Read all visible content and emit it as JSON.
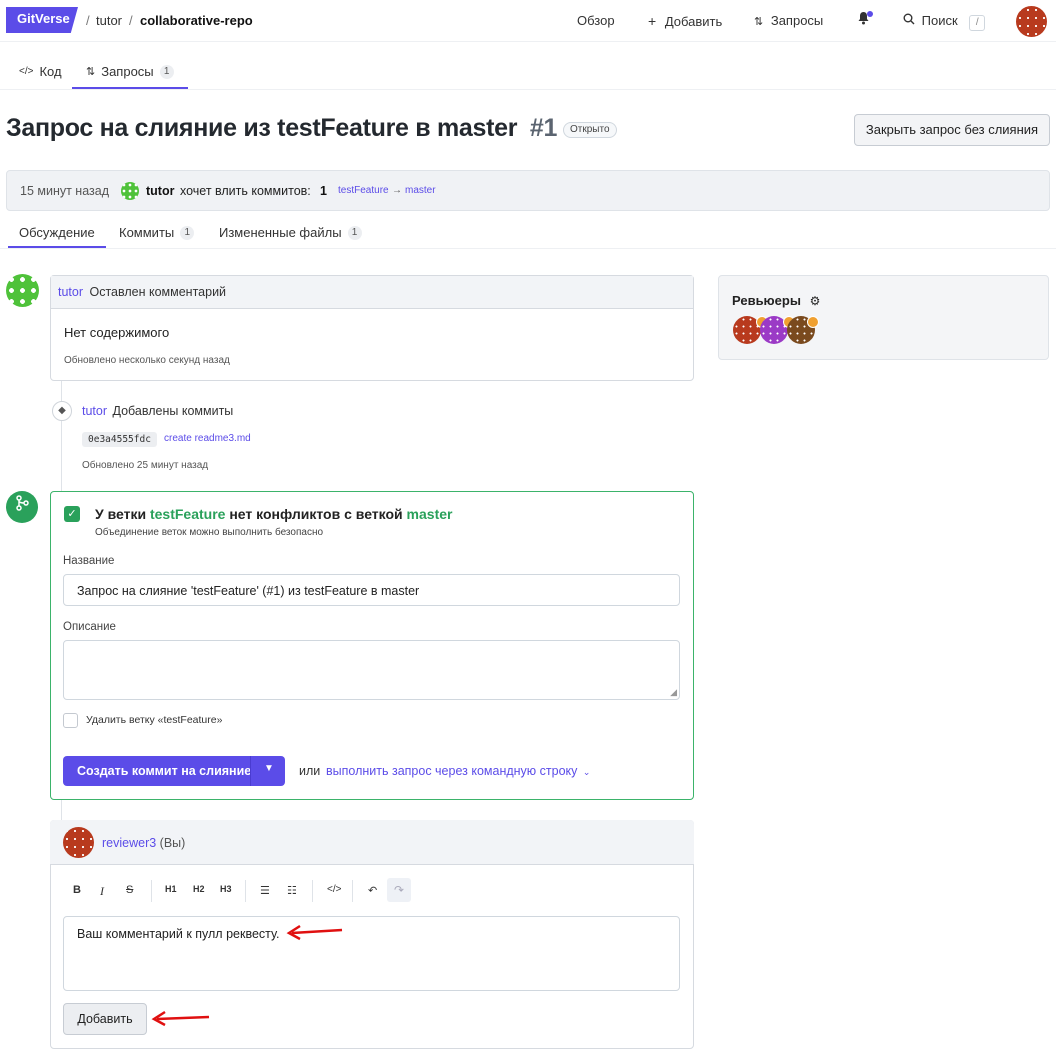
{
  "nav": {
    "logo": "GitVerse",
    "crumb_owner": "tutor",
    "crumb_sep": "/",
    "crumb_repo": "collaborative-repo",
    "overview": "Обзор",
    "add": "Добавить",
    "requests": "Запросы",
    "search": "Поиск",
    "search_shortcut": "/"
  },
  "repo_tabs": {
    "code": "Код",
    "requests": "Запросы",
    "requests_count": "1"
  },
  "pr": {
    "title": "Запрос на слияние из testFeature в master",
    "number": "#1",
    "status": "Открыто",
    "close_button": "Закрыть запрос без слияния",
    "info_time": "15 минут назад",
    "info_user": "tutor",
    "info_text": "хочет влить коммитов:",
    "info_count": "1",
    "info_from": "testFeature",
    "info_arrow": "→",
    "info_to": "master"
  },
  "pr_tabs": {
    "discussion": "Обсуждение",
    "commits": "Коммиты",
    "commits_count": "1",
    "files": "Измененные файлы",
    "files_count": "1"
  },
  "comment": {
    "user": "tutor",
    "action": "Оставлен комментарий",
    "body": "Нет содержимого",
    "updated": "Обновлено несколько секунд назад"
  },
  "commit_event": {
    "user": "tutor",
    "action": "Добавлены коммиты",
    "hash": "0e3a4555fdc",
    "message": "create readme3.md",
    "updated": "Обновлено 25 минут назад"
  },
  "merge": {
    "heading_pre": "У ветки",
    "branch_from": "testFeature",
    "heading_mid": "нет конфликтов с веткой",
    "branch_to": "master",
    "subtitle": "Объединение веток можно выполнить безопасно",
    "name_label": "Название",
    "name_value": "Запрос на слияние 'testFeature' (#1) из testFeature в master",
    "desc_label": "Описание",
    "delete_branch": "Удалить ветку «testFeature»",
    "merge_button": "Создать коммит на слияние",
    "or": "или",
    "cli_link": "выполнить запрос через командную строку"
  },
  "review": {
    "user": "reviewer3",
    "you": "(Вы)",
    "toolbar": [
      "B",
      "I",
      "S",
      "H1",
      "H2",
      "H3"
    ],
    "comment_text": "Ваш комментарий к пулл реквесту.",
    "add_button": "Добавить"
  },
  "reviewers": {
    "title": "Ревьюеры"
  },
  "colors": {
    "accent": "#5b4ce8",
    "success": "#2aa15b",
    "arrow": "#e01010"
  }
}
